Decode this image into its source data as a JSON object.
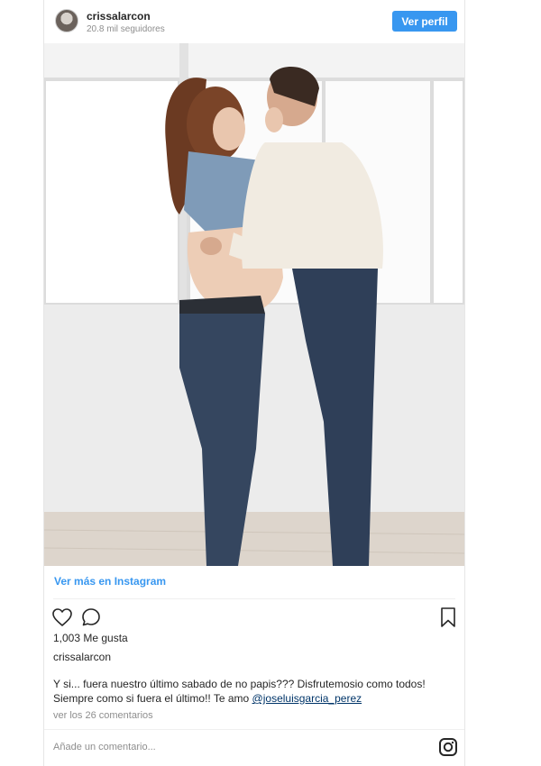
{
  "header": {
    "username": "crissalarcon",
    "followers": "20.8 mil seguidores",
    "profile_button": "Ver perfil"
  },
  "photo": {
    "description_icon": "photo"
  },
  "link": {
    "view_more": "Ver más en Instagram"
  },
  "actions": {
    "like_icon": "heart-icon",
    "comment_icon": "comment-icon",
    "save_icon": "bookmark-icon"
  },
  "likes": "1,003 Me gusta",
  "owner": "crissalarcon",
  "caption": {
    "line1": "Y si... fuera nuestro último sabado de no papis??? Disfrutemosio como todos!",
    "line2_text": "Siempre como si fuera el último!! Te amo ",
    "mention": "@joseluisgarcia_perez"
  },
  "comments_link": "ver los 26 comentarios",
  "comment_input": {
    "placeholder": "Añade un comentario..."
  },
  "colors": {
    "accent": "#3897f0",
    "text": "#262626",
    "muted": "#8e8e8e",
    "mention": "#003569"
  }
}
